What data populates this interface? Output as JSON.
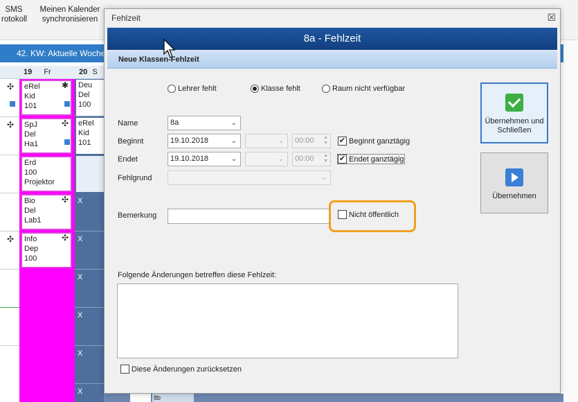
{
  "background_app": {
    "ribbon": [
      {
        "line1": "SMS",
        "line2": "rotokoll"
      },
      {
        "line1": "Meinen Kalender",
        "line2": "synchronisieren"
      }
    ],
    "week_bar": "42. KW: Aktuelle Woche",
    "day_headers": [
      {
        "num": "19",
        "name": "Fr"
      },
      {
        "num": "20",
        "name": "S"
      }
    ],
    "lessons_fr": [
      {
        "subject": "eRel",
        "teacher": "Kid",
        "room": "101"
      },
      {
        "subject": "SpJ",
        "teacher": "Del",
        "room": "Ha1"
      },
      {
        "subject": "Erd",
        "teacher": "100",
        "room": "Projektor"
      },
      {
        "subject": "Bio",
        "teacher": "Del",
        "room": "Lab1"
      },
      {
        "subject": "Info",
        "teacher": "Dep",
        "room": "100"
      }
    ],
    "lessons_sa": [
      {
        "subject": "Deu",
        "teacher": "Del",
        "room": "100"
      },
      {
        "subject": "eRel",
        "teacher": "Kid",
        "room": "101"
      }
    ],
    "x_mark": "X",
    "bottom_label": "8b"
  },
  "dialog": {
    "window_title": "Fehlzeit",
    "banner_title": "8a - Fehlzeit",
    "subheader": "Neue Klassen-Fehlzeit",
    "radio_options": [
      {
        "label": "Lehrer fehlt",
        "selected": false
      },
      {
        "label": "Klasse  fehlt",
        "selected": true
      },
      {
        "label": "Raum nicht verfügbar",
        "selected": false
      }
    ],
    "name_label": "Name",
    "name_value": "8a",
    "begin_label": "Beginnt",
    "begin_date": "19.10.2018",
    "begin_time": "00:00",
    "begin_allday_label": "Beginnt ganztägig",
    "begin_allday_checked": true,
    "end_label": "Endet",
    "end_date": "19.10.2018",
    "end_time": "00:00",
    "end_allday_label": "Endet ganztägig",
    "end_allday_checked": true,
    "reason_label": "Fehlgrund",
    "remark_label": "Bemerkung",
    "not_public_label": "Nicht öffentlich",
    "not_public_checked": false,
    "changes_label": "Folgende Änderungen betreffen diese Fehlzeit:",
    "reset_changes_label": "Diese Änderungen zurücksetzen",
    "btn_apply_close": "Übernehmen und Schließen",
    "btn_apply": "Übernehmen",
    "close_glyph": "☒",
    "check_glyph": "✔"
  }
}
